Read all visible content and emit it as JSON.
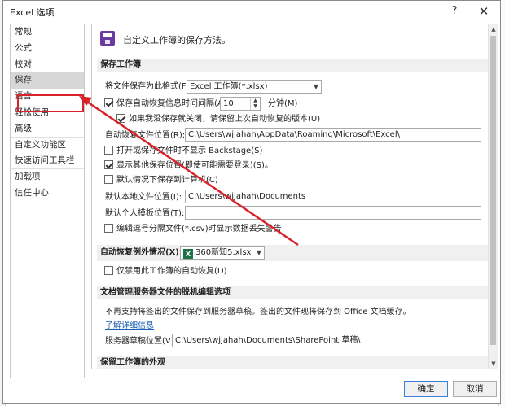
{
  "window": {
    "title": "Excel 选项",
    "help_glyph": "?",
    "close_glyph": "✕"
  },
  "nav": {
    "items": [
      {
        "label": "常规",
        "active": false
      },
      {
        "label": "公式",
        "active": false
      },
      {
        "label": "校对",
        "active": false
      },
      {
        "label": "保存",
        "active": true
      },
      {
        "label": "语言",
        "active": false
      },
      {
        "label": "轻松使用",
        "active": false
      },
      {
        "label": "高级",
        "active": false
      },
      {
        "label": "自定义功能区",
        "active": false
      },
      {
        "label": "快速访问工具栏",
        "active": false
      },
      {
        "label": "加载项",
        "active": false
      },
      {
        "label": "信任中心",
        "active": false
      }
    ]
  },
  "page": {
    "heading": "自定义工作簿的保存方法。",
    "sections": {
      "save_workbook": "保存工作簿",
      "autorecover_exceptions": "自动恢复例外情况(X):",
      "dms_offline": "文档管理服务器文件的脱机编辑选项",
      "preserve_visual": "保留工作簿的外观"
    },
    "save_format": {
      "label": "将文件保存为此格式(F):",
      "value": "Excel 工作簿(*.xlsx)"
    },
    "autorecover_interval": {
      "label": "保存自动恢复信息时间间隔(A)",
      "value": "10",
      "unit": "分钟(M)",
      "checked": true
    },
    "keep_last_version": {
      "label": "如果我没保存就关闭，请保留上次自动恢复的版本(U)",
      "checked": true
    },
    "autorecover_location": {
      "label": "自动恢复文件位置(R):",
      "value": "C:\\Users\\wjjahah\\AppData\\Roaming\\Microsoft\\Excel\\"
    },
    "no_backstage": {
      "label": "打开或保存文件时不显示 Backstage(S)",
      "checked": false
    },
    "show_other_locations": {
      "label": "显示其他保存位置(即使可能需要登录)(S)。",
      "checked": true
    },
    "save_to_computer": {
      "label": "默认情况下保存到计算机(C)",
      "checked": false
    },
    "default_local": {
      "label": "默认本地文件位置(I):",
      "value": "C:\\Users\\wjjahah\\Documents"
    },
    "default_template": {
      "label": "默认个人模板位置(T):",
      "value": ""
    },
    "csv_warning": {
      "label": "编辑逗号分隔文件(*.csv)时显示数据丢失警告",
      "checked": false
    },
    "autorecover_workbook": {
      "value": "360新知5.xlsx"
    },
    "disable_autorecover": {
      "label": "仅禁用此工作簿的自动恢复(D)",
      "checked": false
    },
    "dms_note": "不再支持将签出的文件保存到服务器草稿。签出的文件现将保存到 Office 文档缓存。",
    "learn_more": "了解详细信息",
    "server_drafts": {
      "label": "服务器草稿位置(V):",
      "value": "C:\\Users\\wjjahah\\Documents\\SharePoint 草稿\\"
    }
  },
  "footer": {
    "ok": "确定",
    "cancel": "取消"
  },
  "colors": {
    "highlight": "#d8232a",
    "accent": "#6b3aa0",
    "excel_green": "#1e7145"
  }
}
